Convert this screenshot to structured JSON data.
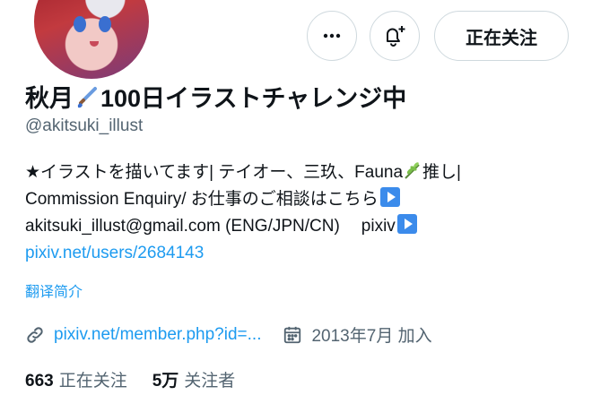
{
  "header": {
    "follow_button_label": "正在关注",
    "more_icon": "more-horizontal-icon",
    "notify_icon": "bell-plus-icon"
  },
  "profile": {
    "name_before_emoji": "秋月",
    "name_after_emoji": "100日イラストチャレンジ中",
    "handle": "@akitsuki_illust"
  },
  "bio": {
    "line1_a": "★イラストを描いてます| テイオー、三玖、Fauna",
    "line1_b": "推し|",
    "line2": "Commission Enquiry/ お仕事のご相談はこちら",
    "line3_email": "akitsuki_illust@gmail.com (ENG/JPN/CN)",
    "line3_pixiv": "pixiv",
    "line4_link": "pixiv.net/users/2684143"
  },
  "translate_label": "翻译简介",
  "meta": {
    "website": "pixiv.net/member.php?id=...",
    "joined": "2013年7月 加入"
  },
  "stats": {
    "following_count": "663",
    "following_label": "正在关注",
    "followers_count": "5万",
    "followers_label": "关注者"
  },
  "colors": {
    "accent": "#1d9bf0",
    "secondary_text": "#536471",
    "border": "#cfd9de"
  }
}
